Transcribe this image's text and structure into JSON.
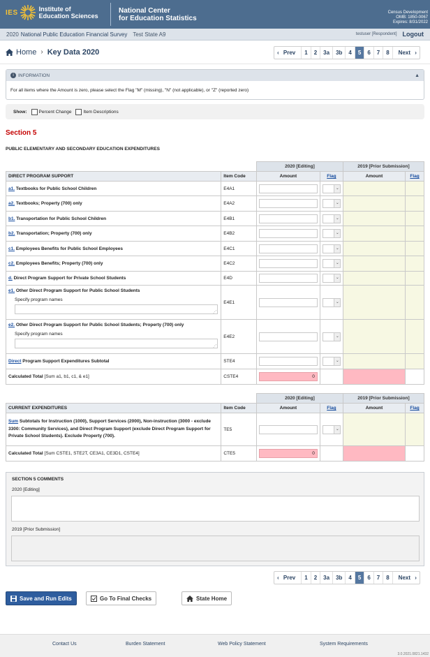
{
  "header": {
    "ies": "IES",
    "institute_line1": "Institute of",
    "institute_line2": "Education Sciences",
    "nces_line1": "National Center",
    "nces_line2": "for Education Statistics",
    "census_line1": "Census Development",
    "census_line2": "OMB: 1850-0067",
    "census_line3": "Expires: 8/31/2022"
  },
  "subbar": {
    "year": "2020",
    "survey": "National Public Education Financial Survey",
    "state": "Test State A9",
    "user": "testuser [Respondent]",
    "logout": "Logout"
  },
  "breadcrumb": {
    "home": "Home",
    "current": "Key Data 2020"
  },
  "pager": {
    "prev": "Prev",
    "next": "Next",
    "pages": [
      "1",
      "2",
      "3a",
      "3b",
      "4",
      "5",
      "6",
      "7",
      "8"
    ],
    "active": "5"
  },
  "info": {
    "title": "INFORMATION",
    "text": "For all items where the Amount is zero, please select the Flag \"M\" (missing), \"N\" (not applicable), or \"Z\" (reported zero)"
  },
  "show": {
    "label": "Show:",
    "opt1": "Percent Change",
    "opt2": "Item Descriptions"
  },
  "section": {
    "title": "Section 5",
    "subtitle": "PUBLIC ELEMENTARY AND SECONDARY EDUCATION EXPENDITURES"
  },
  "table1": {
    "col_editing": "2020 [Editing]",
    "col_prior": "2019 [Prior Submission]",
    "h_desc": "DIRECT PROGRAM SUPPORT",
    "h_code": "Item Code",
    "h_amount": "Amount",
    "h_flag": "Flag",
    "rows": [
      {
        "link": "a1.",
        "text": "Textbooks for Public School Children",
        "code": "E4A1"
      },
      {
        "link": "a2.",
        "text": "Textbooks; Property (700) only",
        "code": "E4A2"
      },
      {
        "link": "b1.",
        "text": "Transportation for Public School Children",
        "code": "E4B1"
      },
      {
        "link": "b2.",
        "text": "Transportation; Property (700) only",
        "code": "E4B2"
      },
      {
        "link": "c1.",
        "text": "Employees Benefits for Public School Employees",
        "code": "E4C1"
      },
      {
        "link": "c2.",
        "text": "Employees Benefits; Property (700) only",
        "code": "E4C2"
      },
      {
        "link": "d.",
        "text": "Direct Program Support for Private School Students",
        "code": "E4D"
      },
      {
        "link": "e1.",
        "text": "Other Direct Program Support for Public School Students",
        "code": "E4E1",
        "specify": "Specify program names"
      },
      {
        "link": "e2.",
        "text": "Other Direct Program Support for Public School Students; Property (700) only",
        "code": "E4E2",
        "specify": "Specify program names"
      },
      {
        "link": "Direct",
        "text": "Program Support Expenditures Subtotal",
        "code": "STE4"
      }
    ],
    "calc": {
      "label": "Calculated Total",
      "detail": "[Sum a1, b1, c1, & e1]",
      "code": "CSTE4",
      "value": "0"
    }
  },
  "table2": {
    "col_editing": "2020 [Editing]",
    "col_prior": "2019 [Prior Submission]",
    "h_desc": "CURRENT EXPENDITURES",
    "h_code": "Item Code",
    "h_amount": "Amount",
    "h_flag": "Flag",
    "row": {
      "link": "Sum",
      "text": "Subtotals for Instruction (1000), Support Services (2000), Non-instruction (3000 - exclude 3300: Community Services), and Direct Program Support (exclude Direct Program Support for Private School Students). Exclude Property (700).",
      "code": "TE5"
    },
    "calc": {
      "label": "Calculated Total",
      "detail": "[Sum CSTE1, STE2T, CE3A1, CE3D1, CSTE4]",
      "code": "CTE5",
      "value": "0"
    }
  },
  "comments": {
    "title": "SECTION 5 COMMENTS",
    "label1": "2020 [Editing]",
    "label2": "2019 [Prior Submission]"
  },
  "buttons": {
    "save": "Save and Run Edits",
    "final": "Go To Final Checks",
    "home": "State Home"
  },
  "footer": {
    "contact": "Contact Us",
    "burden": "Burden Statement",
    "policy": "Web Policy Statement",
    "req": "System Requirements",
    "version": "3.0.2021.0821.1432"
  }
}
